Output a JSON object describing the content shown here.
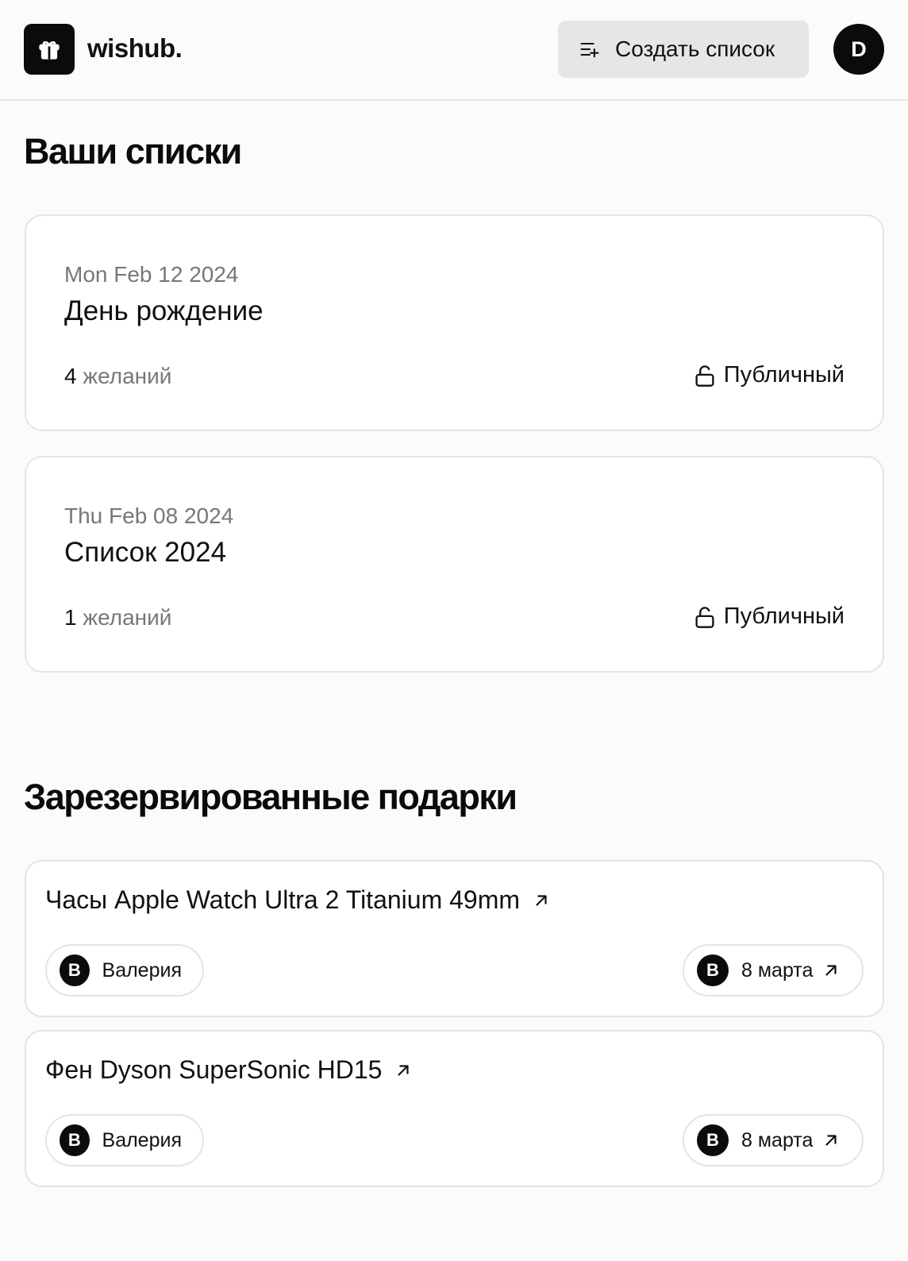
{
  "header": {
    "logo_icon": "gift-icon",
    "logo_text": "wishub.",
    "create_button_label": "Создать список",
    "create_button_icon": "list-add-icon",
    "avatar_initial": "D"
  },
  "lists_section": {
    "title": "Ваши списки",
    "items": [
      {
        "date": "Mon Feb 12 2024",
        "name": "День рождение",
        "count_num": "4",
        "count_label": " желаний",
        "visibility": "Публичный",
        "visibility_icon": "unlock-icon"
      },
      {
        "date": "Thu Feb 08 2024",
        "name": "Список 2024",
        "count_num": "1",
        "count_label": " желаний",
        "visibility": "Публичный",
        "visibility_icon": "unlock-icon"
      }
    ]
  },
  "reserved_section": {
    "title": "Зарезервированные подарки",
    "items": [
      {
        "name": "Часы Apple Watch Ultra 2 Titanium 49mm",
        "link_icon": "arrow-up-right-icon",
        "owner_initial": "В",
        "owner_name": "Валерия",
        "event_initial": "В",
        "event_label": "8 марта"
      },
      {
        "name": "Фен Dyson SuperSonic HD15",
        "link_icon": "arrow-up-right-icon",
        "owner_initial": "В",
        "owner_name": "Валерия",
        "event_initial": "В",
        "event_label": "8 марта"
      }
    ]
  },
  "colors": {
    "accent": "#0b0b0b",
    "background": "#fbfbfb",
    "card_border": "#e4e4e4",
    "muted_text": "#777777",
    "button_bg": "#e6e6e6"
  }
}
